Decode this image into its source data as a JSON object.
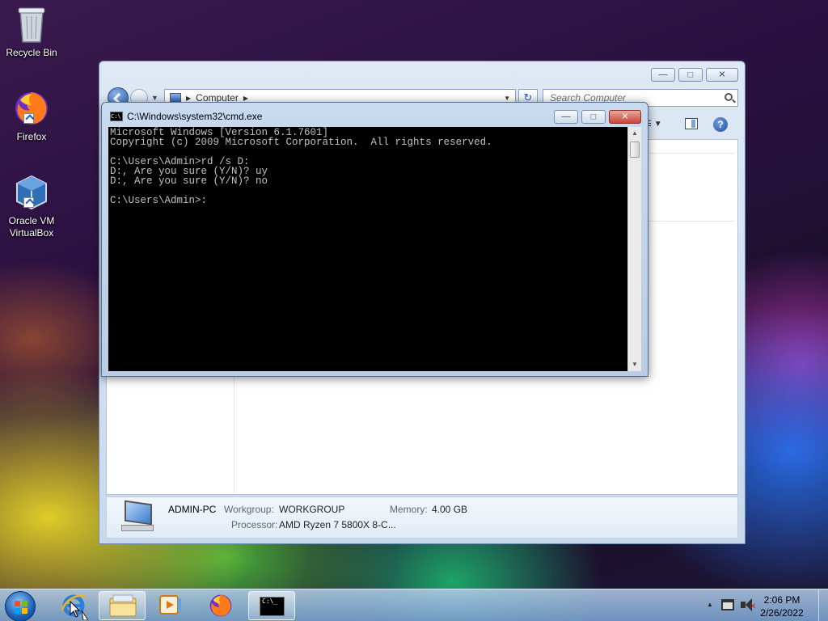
{
  "desktop": {
    "icons": [
      {
        "label": "Recycle Bin",
        "icon": "recycle-bin-icon"
      },
      {
        "label": "Firefox",
        "icon": "firefox-icon"
      },
      {
        "label": "Oracle VM\nVirtualBox",
        "label_line1": "Oracle VM",
        "label_line2": "VirtualBox",
        "icon": "virtualbox-icon"
      }
    ]
  },
  "explorer": {
    "address": {
      "location": "Computer"
    },
    "search": {
      "placeholder": "Search Computer"
    },
    "details": {
      "name": "ADMIN-PC",
      "workgroup_label": "Workgroup:",
      "workgroup_value": "WORKGROUP",
      "memory_label": "Memory:",
      "memory_value": "4.00 GB",
      "processor_label": "Processor:",
      "processor_value": "AMD Ryzen 7 5800X 8-C..."
    }
  },
  "cmd": {
    "title": "C:\\Windows\\system32\\cmd.exe",
    "icon_text": "C:\\",
    "lines": [
      "Microsoft Windows [Version 6.1.7601]",
      "Copyright (c) 2009 Microsoft Corporation.  All rights reserved.",
      "",
      "C:\\Users\\Admin>rd /s D:",
      "D:, Are you sure (Y/N)? uy",
      "D:, Are you sure (Y/N)? no",
      "",
      "C:\\Users\\Admin>:"
    ]
  },
  "taskbar": {
    "clock_time": "2:06 PM",
    "clock_date": "2/26/2022"
  }
}
